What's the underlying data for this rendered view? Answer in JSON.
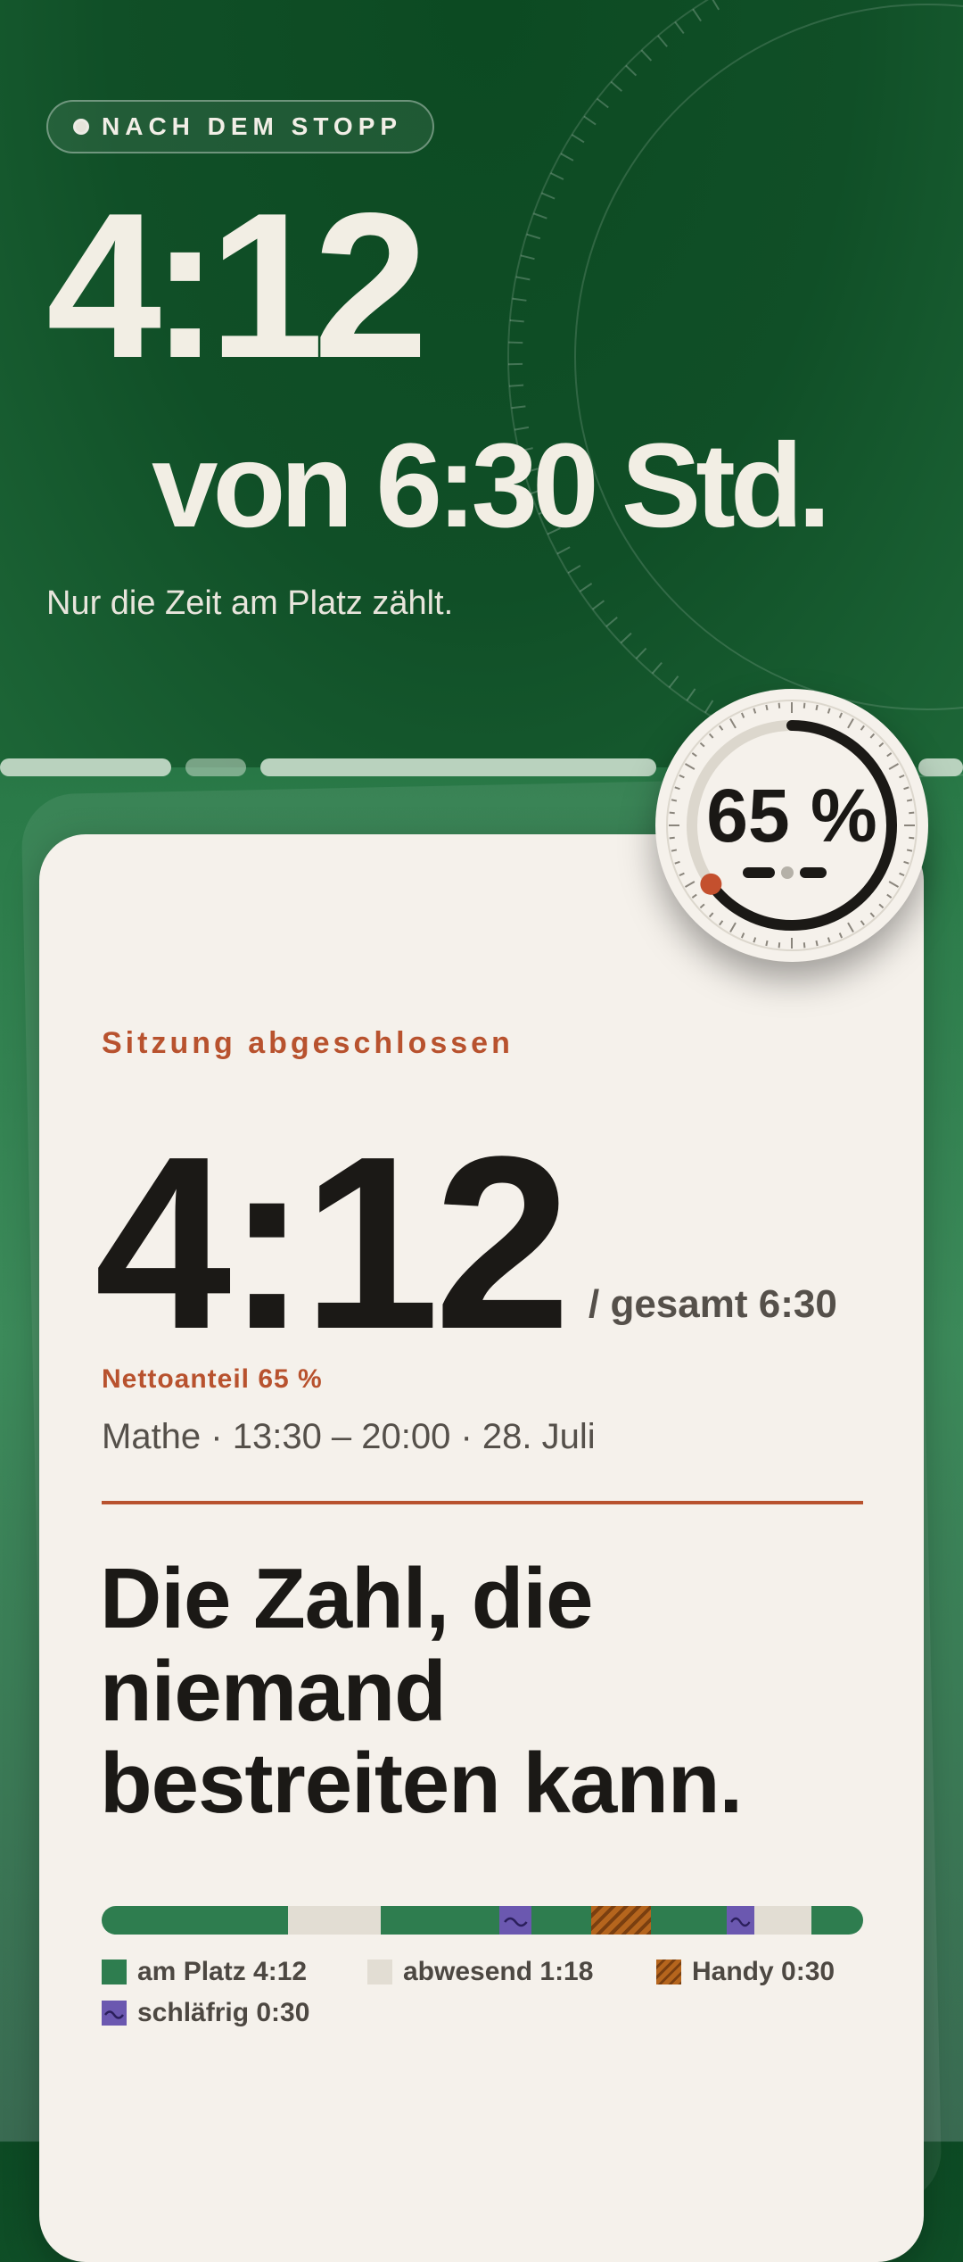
{
  "hero": {
    "badge": "NACH DEM STOPP",
    "time_big": "4:12",
    "total_line": "von 6:30 Std.",
    "subtitle": "Nur die Zeit am Platz zählt."
  },
  "gauge": {
    "percent_label": "65 %",
    "progress": 0.65
  },
  "card": {
    "status_label": "Sitzung abgeschlossen",
    "time_big": "4:12",
    "total": "/ gesamt 6:30",
    "net_share": "Nettoanteil 65 %",
    "meta": "Mathe · 13:30 – 20:00 · 28. Juli",
    "headline_lines": [
      "Die Zahl, die",
      "niemand",
      "bestreiten kann."
    ]
  },
  "timeline": [
    {
      "type": "am-platz",
      "fraction": 0.245
    },
    {
      "type": "abwesend",
      "fraction": 0.122
    },
    {
      "type": "am-platz",
      "fraction": 0.155
    },
    {
      "type": "schlaefrig",
      "fraction": 0.043
    },
    {
      "type": "am-platz",
      "fraction": 0.078
    },
    {
      "type": "handy",
      "fraction": 0.078
    },
    {
      "type": "am-platz",
      "fraction": 0.1
    },
    {
      "type": "schlaefrig",
      "fraction": 0.036
    },
    {
      "type": "abwesend",
      "fraction": 0.075
    },
    {
      "type": "am-platz",
      "fraction": 0.068
    }
  ],
  "legend": {
    "am_platz": "am Platz 4:12",
    "abwesend": "abwesend 1:18",
    "handy": "Handy 0:30",
    "schlaefrig": "schläfrig 0:30"
  },
  "colors": {
    "hero_green": "#0d4a24",
    "am_platz": "#2e7d4f",
    "abwesend": "#e2ddd3",
    "handy": "#b5651d",
    "schlaefrig": "#6b58b0",
    "accent": "#b8522e",
    "card_bg": "#f5f1eb"
  }
}
